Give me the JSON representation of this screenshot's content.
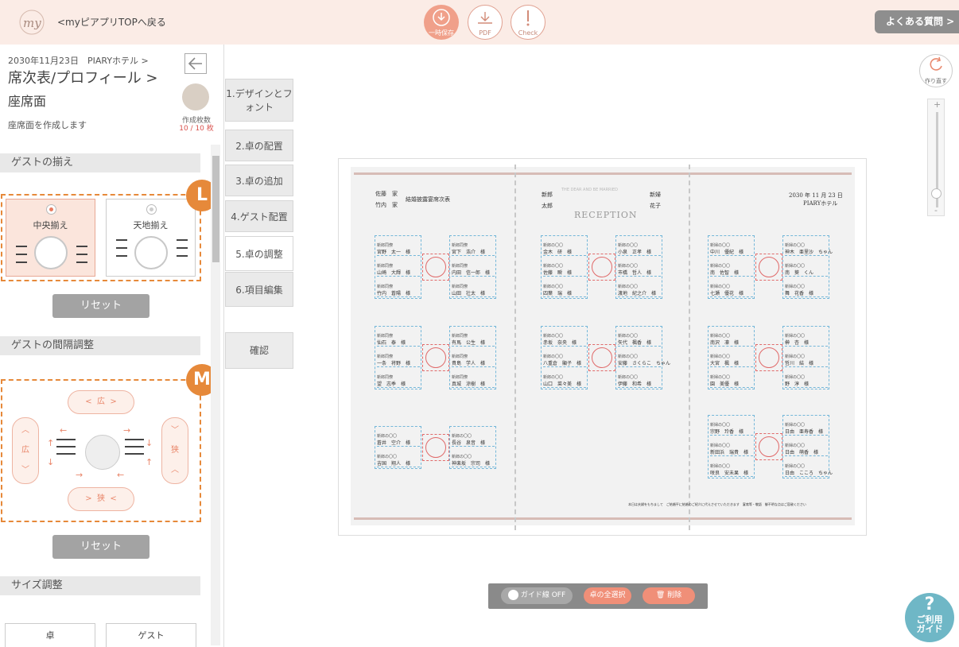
{
  "header": {
    "logo_text": "my",
    "back_link": "<myピアプリTOPへ戻る",
    "actions": [
      {
        "label": "一時保存",
        "icon": "download-icon"
      },
      {
        "label": "PDF",
        "icon": "pdf-icon"
      },
      {
        "label": "Check",
        "icon": "exclamation-icon"
      }
    ],
    "faq_label": "よくある質問 >"
  },
  "left_panel": {
    "date_line": "2030年11月23日　PIARYホテル >",
    "breadcrumb_1": "席次表/プロフィール >",
    "breadcrumb_2": "座席面",
    "description": "座席面を作成します",
    "count_label": "作成枚数",
    "count_value": "10 / 10 枚",
    "sections": {
      "align_title": "ゲストの揃え",
      "align_badge": "L",
      "align_options": [
        "中央揃え",
        "天地揃え"
      ],
      "reset_label": "リセット",
      "spacing_title": "ゲストの間隔調整",
      "spacing_badge": "M",
      "spacing_wide": "広",
      "spacing_narrow": "狭",
      "size_title": "サイズ調整",
      "size_options": [
        "卓",
        "ゲスト"
      ]
    }
  },
  "steps": [
    "1.デザインとフォント",
    "2.卓の配置",
    "3.卓の追加",
    "4.ゲスト配置",
    "5.卓の調整",
    "6.項目編集"
  ],
  "confirm_label": "確認",
  "document": {
    "left_header_1": "佐藤　家",
    "left_header_2": "竹内　家",
    "left_header_title": "結婚披露宴席次表",
    "groom_label": "新郎",
    "groom_name": "太郎",
    "bride_label": "新婦",
    "bride_name": "花子",
    "reception_sub": "THE DEAR AND BE MARRIED",
    "reception": "RECEPTION",
    "right_date": "2030 年 11 月 23 日",
    "right_venue": "PIARYホテル",
    "footer_note": "本日は夫婦をもちまして　ご結婚平に結婚のご紹介に代えさせていただきます　宴席等・敬語　御不明な点はご容赦ください",
    "tables": [
      {
        "left": [
          [
            "新郎同僚",
            "宮野　太一　様"
          ],
          [
            "新郎同僚",
            "山崎　大輝　様"
          ],
          [
            "新郎同僚",
            "竹内　蒼陽　様"
          ]
        ],
        "right": [
          [
            "新郎同僚",
            "宮下　浩介　様"
          ],
          [
            "新郎同僚",
            "内田　信一郎　様"
          ],
          [
            "新郎同僚",
            "山田　壮太　様"
          ]
        ]
      },
      {
        "left": [
          [
            "新郎の〇〇",
            "金木　研　様"
          ],
          [
            "新郎の〇〇",
            "佐藤　瞬　様"
          ],
          [
            "新郎の〇〇",
            "四葉　瑞　様"
          ]
        ],
        "right": [
          [
            "新郎の〇〇",
            "小泉　正孝　様"
          ],
          [
            "新郎の〇〇",
            "市橋　哲人　様"
          ],
          [
            "新郎の〇〇",
            "渡地　紀之介　様"
          ]
        ]
      },
      {
        "left": [
          [
            "新婦の〇〇",
            "中川　優紀　様"
          ],
          [
            "新婦の〇〇",
            "南　佐智　様"
          ],
          [
            "新婦の〇〇",
            "七瀬　優花　様"
          ]
        ],
        "right": [
          [
            "新婦の〇〇",
            "神木　亜里沙　ちゃん"
          ],
          [
            "新婦の〇〇",
            "南　葵　くん"
          ],
          [
            "新婦の〇〇",
            "舞　花香　様"
          ]
        ]
      },
      {
        "left": [
          [
            "新郎同僚",
            "仙石　泰　様"
          ],
          [
            "新郎同僚",
            "一条　将野　様"
          ],
          [
            "新郎同僚",
            "望　志季　様"
          ]
        ],
        "right": [
          [
            "新郎同僚",
            "有馬　公生　様"
          ],
          [
            "新郎同僚",
            "貴島　学人　様"
          ],
          [
            "新郎同僚",
            "真城　涼樹　様"
          ]
        ]
      },
      {
        "left": [
          [
            "新郎の〇〇",
            "赤坂　奈央　様"
          ],
          [
            "新郎の〇〇",
            "八重倉　顯子　様"
          ],
          [
            "新郎の〇〇",
            "山口　菜々美　様"
          ]
        ],
        "right": [
          [
            "新郎の〇〇",
            "矢代　楓香　様"
          ],
          [
            "新郎の〇〇",
            "安藤　さくらこ　ちゃん"
          ],
          [
            "新郎の〇〇",
            "伊藤　和希　様"
          ]
        ]
      },
      {
        "left": [
          [
            "新婦の〇〇",
            "南沢　凛　様"
          ],
          [
            "新婦の〇〇",
            "大宮　楓　様"
          ],
          [
            "新婦の〇〇",
            "園　美優　様"
          ]
        ],
        "right": [
          [
            "新婦の〇〇",
            "榊　杏　様"
          ],
          [
            "新婦の〇〇",
            "哲川　結　様"
          ],
          [
            "新婦の〇〇",
            "野　淳　様"
          ]
        ]
      },
      {
        "left": [
          [
            "新郎の〇〇",
            "蒼井　空介　様"
          ],
          [
            "新郎の〇〇",
            "吉国　翔人　様"
          ]
        ],
        "right": [
          [
            "新郎の〇〇",
            "長谷　泉音　様"
          ],
          [
            "新郎の〇〇",
            "神楽坂　宗司　様"
          ]
        ]
      },
      {
        "left": [
          [
            "新婦の〇〇",
            "宗野　玲香　様"
          ],
          [
            "新婦の〇〇",
            "新田浜　瑞貴　様"
          ],
          [
            "新婦の〇〇",
            "咲良　安未果　様"
          ]
        ],
        "right": [
          [
            "新婦の〇〇",
            "日由　亜寿香　様"
          ],
          [
            "新婦の〇〇",
            "日由　萌香　様"
          ],
          [
            "新婦の〇〇",
            "日由　こころ　ちゃん"
          ]
        ]
      }
    ]
  },
  "right_tools": {
    "redo_label": "作り直す",
    "zoom_plus": "+",
    "zoom_minus": "-",
    "zoom_level": 0.9
  },
  "toolbar": {
    "guide_toggle": "ガイド線 OFF",
    "select_all": "卓の全選択",
    "delete": "削除"
  },
  "help": {
    "line1": "ご利用",
    "line2": "ガイド"
  },
  "colors": {
    "accent": "#f0a08a",
    "orange_badge": "#e6893a",
    "guide_blue": "#74b7d9",
    "table_red": "#e06a6a",
    "help_teal": "#6fb7c6"
  }
}
